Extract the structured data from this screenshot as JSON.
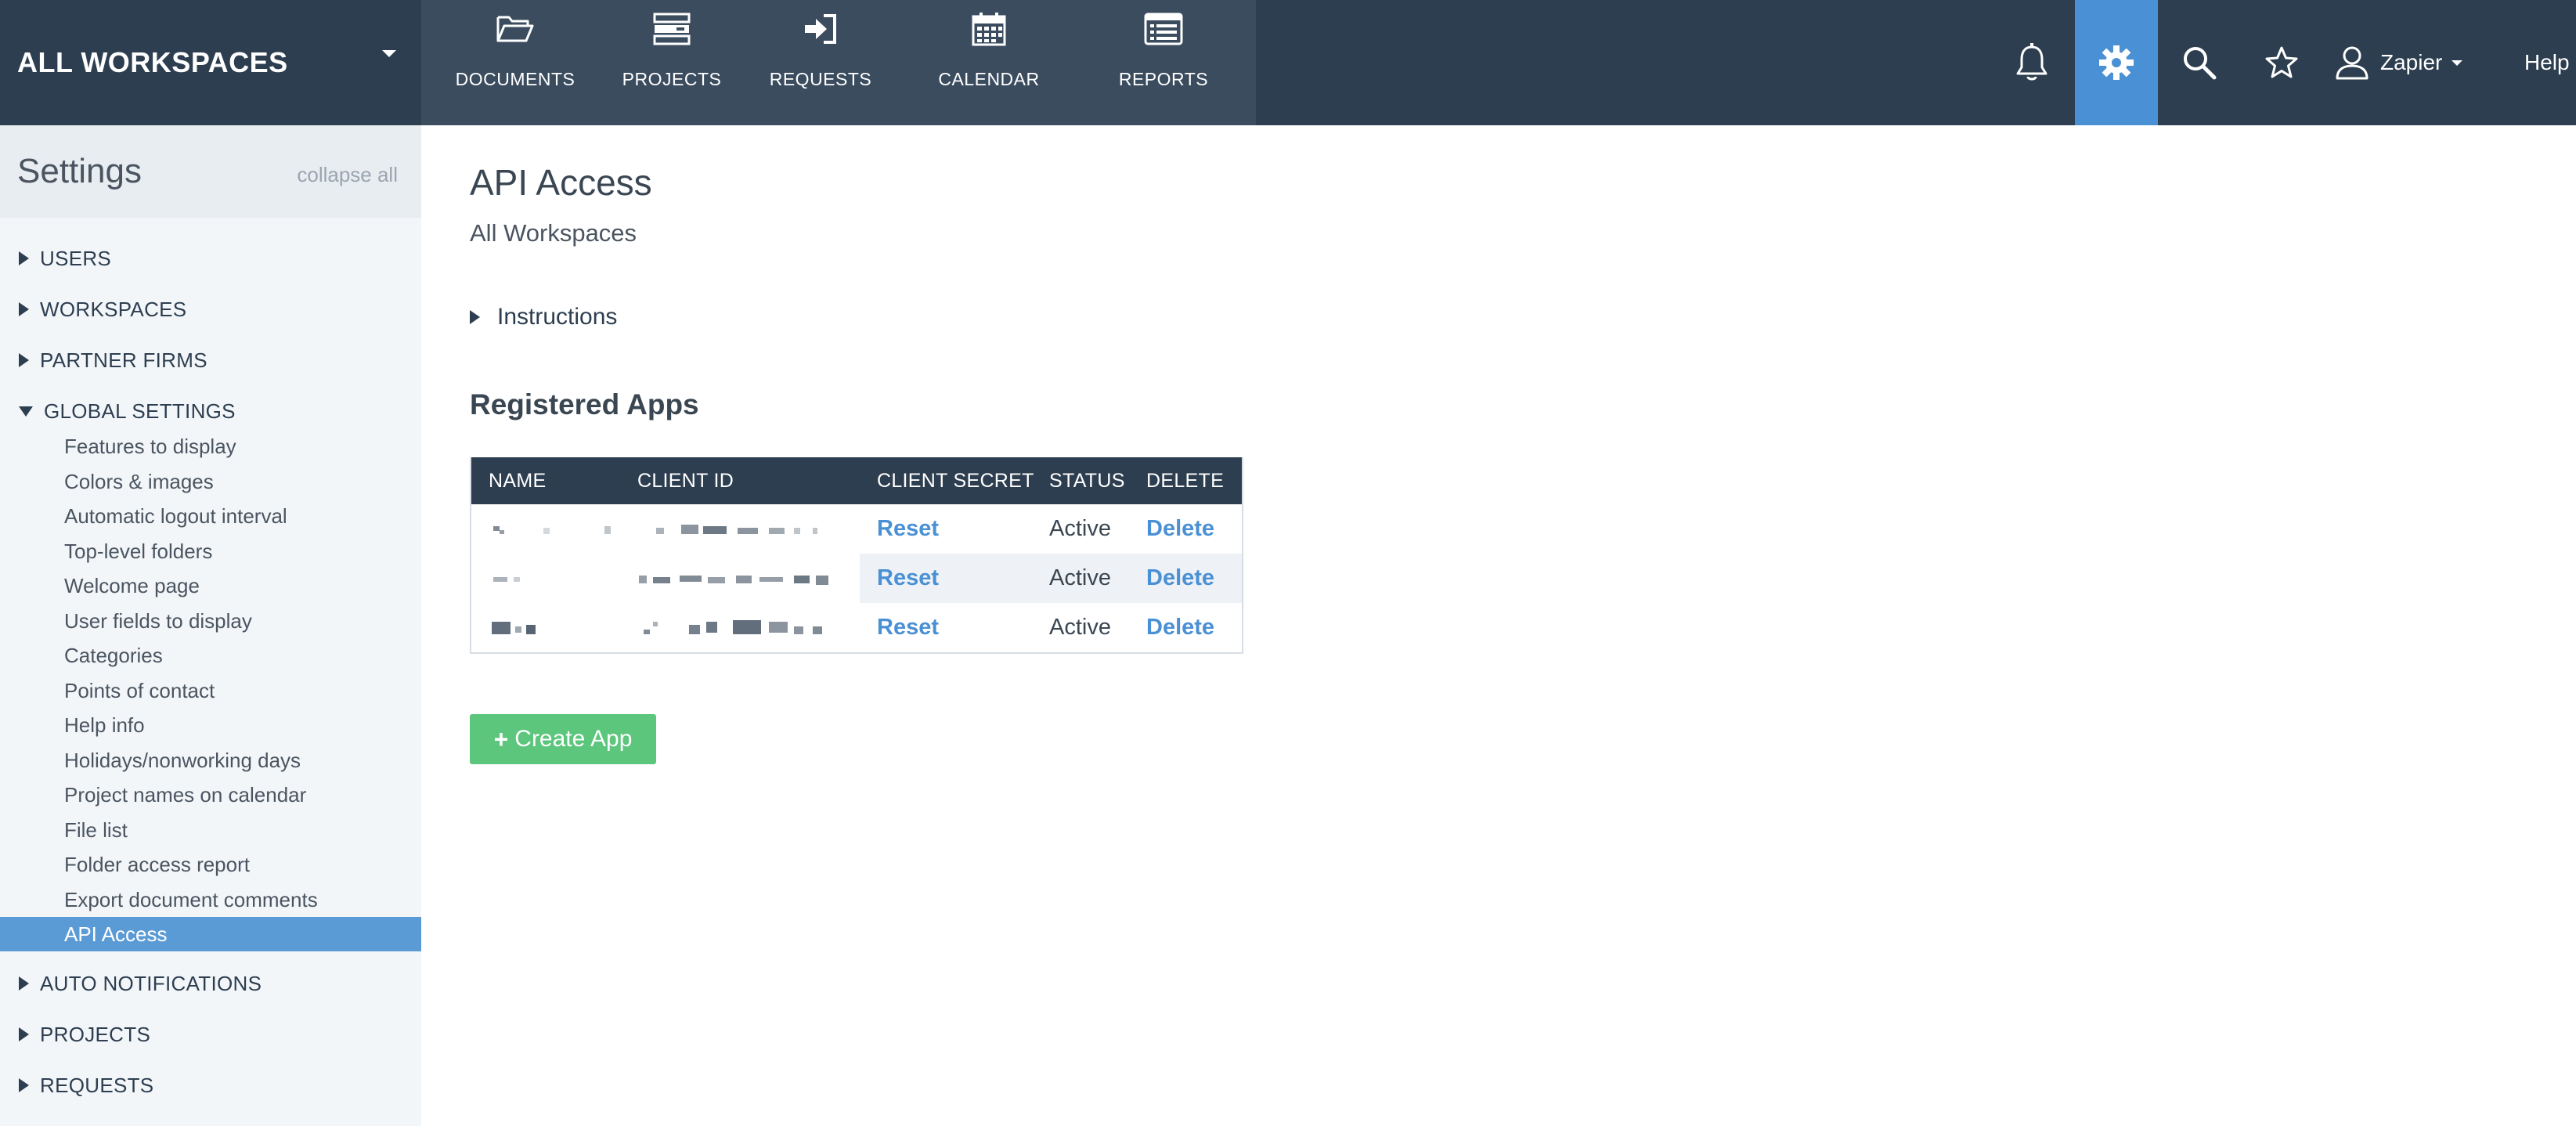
{
  "workspace_switcher": {
    "label": "ALL WORKSPACES"
  },
  "nav": {
    "items": [
      {
        "label": "DOCUMENTS",
        "icon": "folder-open-icon"
      },
      {
        "label": "PROJECTS",
        "icon": "server-stack-icon"
      },
      {
        "label": "REQUESTS",
        "icon": "sign-in-icon"
      },
      {
        "label": "CALENDAR",
        "icon": "calendar-icon"
      },
      {
        "label": "REPORTS",
        "icon": "list-alt-icon"
      }
    ]
  },
  "toolbar": {
    "icons": [
      "bell-icon",
      "gear-icon",
      "search-icon",
      "star-icon",
      "user-icon"
    ],
    "user_name": "Zapier",
    "help_label": "Help",
    "active_color": "#4a90d4"
  },
  "sidebar": {
    "title": "Settings",
    "collapse_all": "collapse all",
    "sections": [
      {
        "label": "USERS",
        "expanded": false
      },
      {
        "label": "WORKSPACES",
        "expanded": false
      },
      {
        "label": "PARTNER FIRMS",
        "expanded": false
      },
      {
        "label": "GLOBAL SETTINGS",
        "expanded": true
      },
      {
        "label": "AUTO NOTIFICATIONS",
        "expanded": false
      },
      {
        "label": "PROJECTS",
        "expanded": false
      },
      {
        "label": "REQUESTS",
        "expanded": false
      }
    ],
    "global_settings_items": [
      "Features to display",
      "Colors & images",
      "Automatic logout interval",
      "Top-level folders",
      "Welcome page",
      "User fields to display",
      "Categories",
      "Points of contact",
      "Help info",
      "Holidays/nonworking days",
      "Project names on calendar",
      "File list",
      "Folder access report",
      "Export document comments",
      "API Access"
    ],
    "active_item": "API Access",
    "active_color": "#5b9bd5"
  },
  "main": {
    "title": "API Access",
    "subtitle": "All Workspaces",
    "instructions_label": "Instructions",
    "registered_apps_title": "Registered Apps",
    "table": {
      "headers": [
        "NAME",
        "CLIENT ID",
        "CLIENT SECRET",
        "STATUS",
        "DELETE"
      ],
      "rows": [
        {
          "secret_action": "Reset",
          "status": "Active",
          "delete_action": "Delete"
        },
        {
          "secret_action": "Reset",
          "status": "Active",
          "delete_action": "Delete"
        },
        {
          "secret_action": "Reset",
          "status": "Active",
          "delete_action": "Delete"
        }
      ]
    },
    "create_button": {
      "label": "Create App",
      "icon": "plus-icon",
      "color": "#5cc67c"
    }
  }
}
